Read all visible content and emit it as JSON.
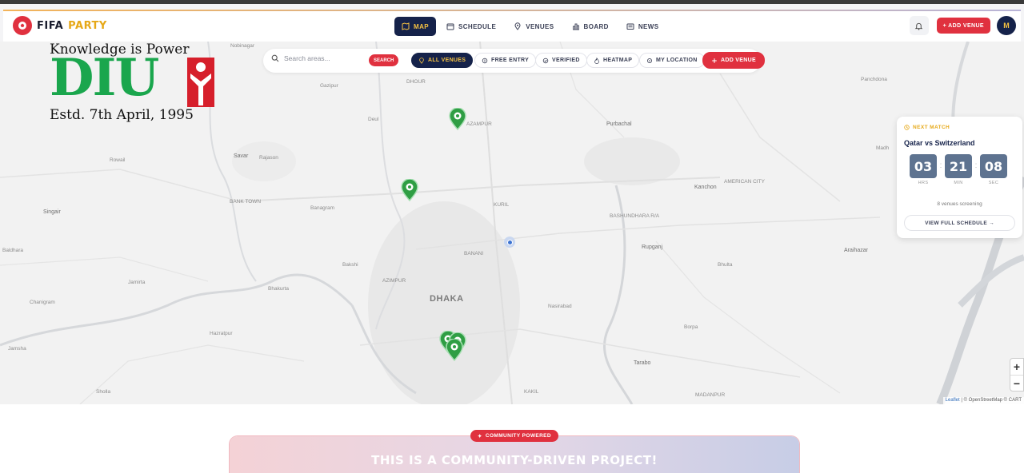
{
  "brand": {
    "name_part1": "FIFA",
    "name_part2": "PARTY"
  },
  "nav": {
    "links": [
      {
        "label": "MAP",
        "icon": "map-icon",
        "active": true
      },
      {
        "label": "SCHEDULE",
        "icon": "calendar-icon"
      },
      {
        "label": "VENUES",
        "icon": "location-pin-icon"
      },
      {
        "label": "BOARD",
        "icon": "bar-chart-icon"
      },
      {
        "label": "NEWS",
        "icon": "newspaper-icon"
      }
    ],
    "add_venue": "+ ADD VENUE",
    "avatar_initial": "M"
  },
  "watermark": {
    "tagline": "Knowledge is Power",
    "logo": "DIU",
    "established": "Estd. 7th April, 1995"
  },
  "toolbar": {
    "search_placeholder": "Search areas...",
    "search_button": "SEARCH",
    "filters": [
      {
        "label": "ALL VENUES",
        "active": true
      },
      {
        "label": "FREE ENTRY"
      },
      {
        "label": "VERIFIED"
      },
      {
        "label": "HEATMAP"
      },
      {
        "label": "MY LOCATION"
      }
    ],
    "add_venue": "ADD VENUE"
  },
  "map": {
    "labels": {
      "dhaka": "DHAKA",
      "purbachal": "Purbachal",
      "kanchon": "Kanchon",
      "rupganj": "Rupganj",
      "araihazar": "Araihazar",
      "bhulta": "Bhulta",
      "borpa": "Borpa",
      "tarabo": "Tarabo",
      "nobinagar": "Nobinagar",
      "gazipur": "Gazipur",
      "dhour": "DHOUR",
      "azampur": "AZAMPUR",
      "deul": "Deul",
      "savar": "Savar",
      "rajason": "Rajason",
      "rowail": "Rowail",
      "singair": "Singair",
      "banagram": "Banagram",
      "bank_town": "BANK TOWN",
      "baldhara": "Baldhara",
      "jamirta": "Jamirta",
      "chanigram": "Chanigram",
      "bakshi": "Bakshi",
      "bhakurta": "Bhakurta",
      "hazratpur": "Hazratpur",
      "jamsha": "Jamsha",
      "sholla": "Sholla",
      "nasirabad": "Nasirabad",
      "banani": "BANANI",
      "kuril": "KURIL",
      "azimpur": "AZIMPUR",
      "bashundhara": "BASHUNDHARA R/A",
      "american_city": "AMERICAN CITY",
      "madhabdi": "Madhabdi",
      "panchdona": "Panchdona",
      "madanpur": "MADANPUR",
      "kakil": "KAKIL",
      "bhaluka": "Madh"
    },
    "attribution_leaflet": "Leaflet",
    "attribution_rest": " | © OpenStreetMap © CART",
    "zoom_in": "+",
    "zoom_out": "−"
  },
  "next_match": {
    "label": "NEXT MATCH",
    "teams": "Qatar vs Switzerland",
    "hours": "03",
    "minutes": "21",
    "seconds": "08",
    "hours_caption": "HRS",
    "minutes_caption": "MIN",
    "seconds_caption": "SEC",
    "screening": "8 venues screening",
    "schedule_button": "VIEW FULL SCHEDULE →"
  },
  "community": {
    "badge": "COMMUNITY POWERED",
    "headline": "THIS IS A COMMUNITY-DRIVEN PROJECT!"
  },
  "colors": {
    "brand_red": "#e0313f",
    "navy": "#15224a",
    "gold": "#f6c242",
    "pin_green": "#2f9e44"
  }
}
